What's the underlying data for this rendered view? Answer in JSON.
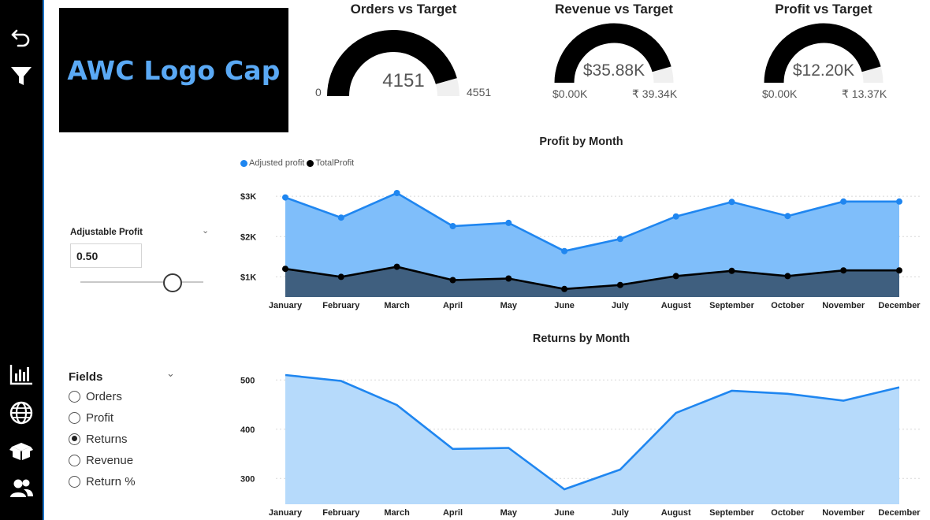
{
  "sidebar": {
    "icons": [
      "back-arrow-icon",
      "filter-icon",
      "bar-chart-icon",
      "globe-icon",
      "box-icon",
      "users-icon"
    ]
  },
  "logo": {
    "text": "AWC Logo Cap"
  },
  "gauges": [
    {
      "title": "Orders vs Target",
      "value": "4151",
      "min": "0",
      "max": "4551",
      "fill": 0.912
    },
    {
      "title": "Revenue vs Target",
      "value": "$35.88K",
      "min": "$0.00K",
      "max": "₹ 39.34K",
      "fill": 0.912
    },
    {
      "title": "Profit vs Target",
      "value": "$12.20K",
      "min": "$0.00K",
      "max": "₹ 13.37K",
      "fill": 0.912
    }
  ],
  "adjustable": {
    "label": "Adjustable Profit",
    "value": "0.50",
    "slider_level": 0.75
  },
  "fields": {
    "title": "Fields",
    "options": [
      "Orders",
      "Profit",
      "Returns",
      "Revenue",
      "Return %"
    ],
    "selected": "Returns"
  },
  "colors": {
    "adjusted_area": "#7fbefa",
    "adjusted_line": "#1f86f0",
    "total_area": "#3f5f7f",
    "total_line": "#000000",
    "returns_area": "#b6dafb",
    "returns_line": "#1f86f0"
  },
  "chart_data": [
    {
      "type": "area",
      "title": "Profit by Month",
      "categories": [
        "January",
        "February",
        "March",
        "April",
        "May",
        "June",
        "July",
        "August",
        "September",
        "October",
        "November",
        "December"
      ],
      "series": [
        {
          "name": "Adjusted profit",
          "values": [
            2970,
            2470,
            3080,
            2260,
            2340,
            1640,
            1940,
            2500,
            2860,
            2510,
            2870,
            2870
          ]
        },
        {
          "name": "TotalProfit",
          "values": [
            1200,
            1000,
            1250,
            920,
            960,
            700,
            800,
            1020,
            1150,
            1020,
            1160,
            1160
          ]
        }
      ],
      "yticks": [
        "$1K",
        "$2K",
        "$3K"
      ],
      "ylim": [
        500,
        3100
      ],
      "legend": "top-left",
      "grid": true
    },
    {
      "type": "area",
      "title": "Returns by Month",
      "categories": [
        "January",
        "February",
        "March",
        "April",
        "May",
        "June",
        "July",
        "August",
        "September",
        "October",
        "November",
        "December"
      ],
      "series": [
        {
          "values": [
            510,
            498,
            449,
            360,
            362,
            278,
            318,
            433,
            478,
            472,
            458,
            485
          ]
        }
      ],
      "yticks": [
        "300",
        "400",
        "500"
      ],
      "ylim": [
        270,
        510
      ],
      "grid": true
    }
  ]
}
